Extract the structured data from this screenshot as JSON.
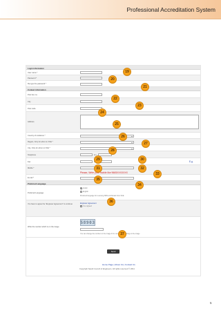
{
  "header": {
    "title": "Professional Accreditation System"
  },
  "sections": {
    "login": "Login information",
    "contact": "Contact information"
  },
  "labels": {
    "username": "User name *",
    "password": "Password *",
    "retype": "Re-type the password *",
    "pobox": "Post box no.",
    "city": "City",
    "postcode": "Post code",
    "address": "Address",
    "country": "Country of residence *",
    "region": "Region, Only for whom in KSA *",
    "city_ksa": "City, Only for whom in KSA *",
    "telephone": "Telephone",
    "fax": "Fax",
    "mobile": "Mobile *",
    "email": "E-mail *",
    "pref_lang_section": "Preferred Language",
    "pref_lang": "Preferred Language",
    "agree": "You have to agree the \"Engineer Agreement\" to continue",
    "captcha_label": "Write the number which is on the image"
  },
  "small": {
    "ext": "Ext.",
    "ext2": "Ext.",
    "lang_hint": "Preferred language for receiving SMS and Emails from SCE",
    "captcha_hint": "You can change the number on the image if it is not clear by clicking on the image",
    "agreed": "Yes, Agreed",
    "e_g": "E.g."
  },
  "mobile_hint": "Please, Write your mobile like 9665XXXXXXX",
  "languages": [
    "Arabic",
    "English"
  ],
  "agreement_link": "Engineer Agreement",
  "captcha_value": "58903",
  "send_label": "Send",
  "footer": {
    "links": "Home Page | About Us | Contact Us",
    "copyright": "Copyright Saudi Council of Engineers. All rights reserved © 2011"
  },
  "badges": [
    "19",
    "20",
    "21",
    "22",
    "23",
    "24",
    "25",
    "26",
    "27",
    "28",
    "29",
    "30",
    "31",
    "32",
    "33",
    "34",
    "35",
    "36",
    "37"
  ],
  "page_number": "5",
  "colors": {
    "badge": "#f6a11a",
    "accent": "#f6c79a",
    "hint_red": "#d42020"
  }
}
